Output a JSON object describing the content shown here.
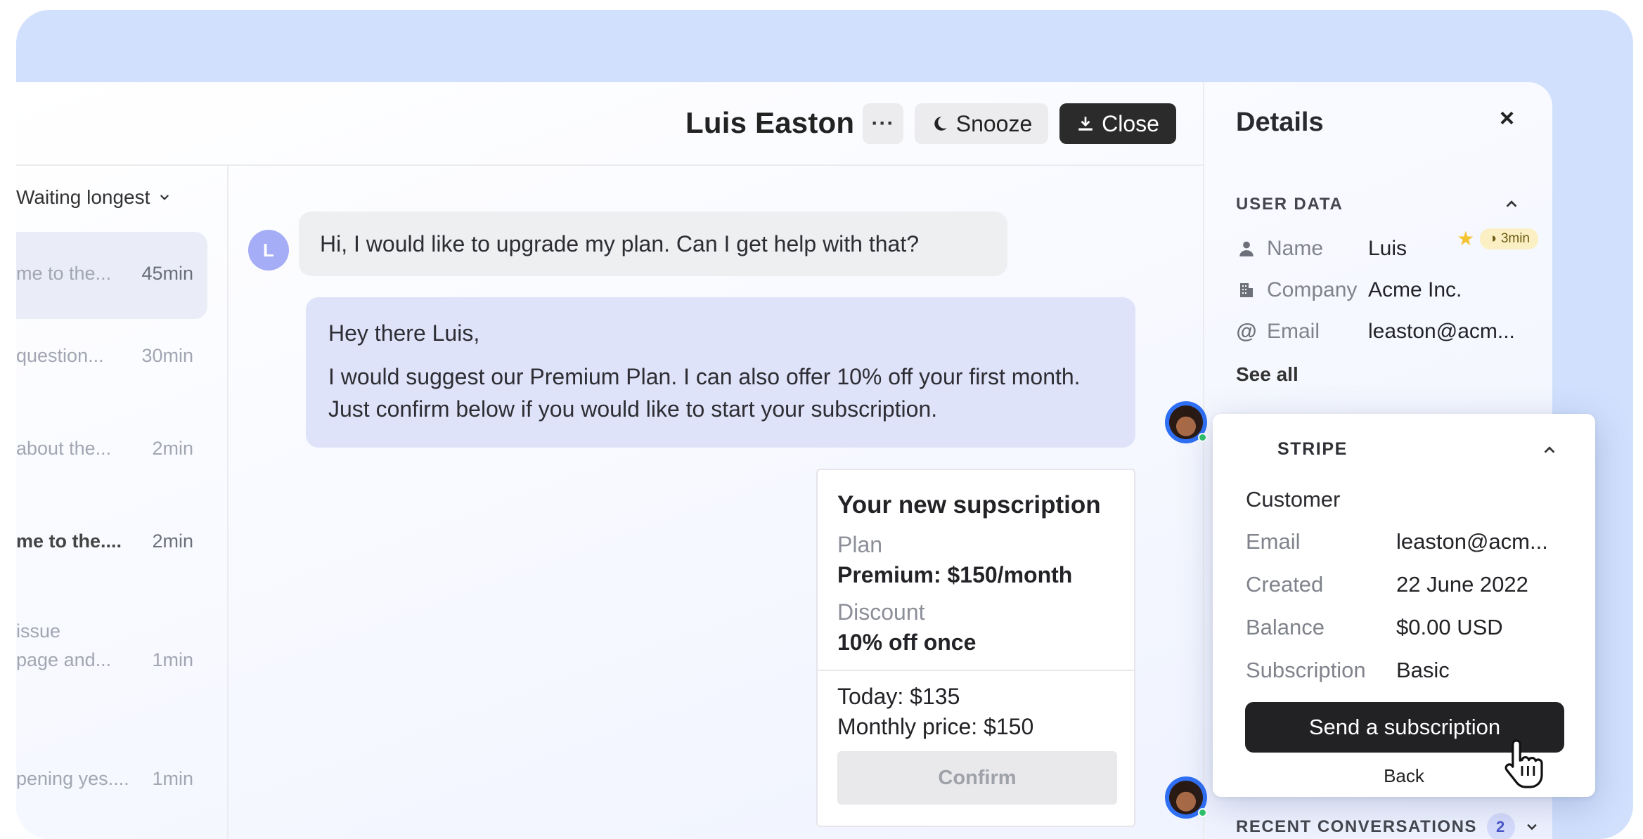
{
  "header": {
    "contact_name": "Luis Easton",
    "more_label": "···",
    "snooze_label": "Snooze",
    "close_label": "Close"
  },
  "inbox": {
    "sort_label": "Waiting longest",
    "items": [
      {
        "snippet": "me to the...",
        "time": "45min",
        "active": true
      },
      {
        "snippet": "question...",
        "time": "30min",
        "sla": "3min",
        "starred": true
      },
      {
        "snippet": "about the...",
        "time": "2min"
      },
      {
        "snippet": "me to the....",
        "time": "2min",
        "unread": true
      },
      {
        "snippet_line1": "issue",
        "snippet": "page and...",
        "time": "1min"
      },
      {
        "snippet": "pening yes....",
        "time": "1min"
      }
    ]
  },
  "conversation": {
    "customer_initial": "L",
    "customer_message": "Hi, I would like to upgrade my plan. Can I get help with that?",
    "agent_greeting": "Hey there Luis,",
    "agent_message": "I would suggest our Premium Plan. I can also offer 10% off your first month. Just confirm below if you would like to start your subscription."
  },
  "subscription_card": {
    "title": "Your new supscription",
    "plan_label": "Plan",
    "plan_value": "Premium: $150/month",
    "discount_label": "Discount",
    "discount_value": "10% off once",
    "today": "Today: $135",
    "monthly": "Monthly price: $150",
    "confirm_label": "Confirm"
  },
  "details": {
    "title": "Details",
    "close_glyph": "×",
    "user_data_header": "USER DATA",
    "fields": [
      {
        "icon": "person-icon",
        "label": "Name",
        "value": "Luis"
      },
      {
        "icon": "building-icon",
        "label": "Company",
        "value": "Acme Inc."
      },
      {
        "icon": "at-icon",
        "label": "Email",
        "value": "leaston@acm..."
      }
    ],
    "see_all": "See all",
    "recent_header": "RECENT CONVERSATIONS",
    "recent_count": "2"
  },
  "stripe": {
    "header": "STRIPE",
    "customer_label": "Customer",
    "rows": [
      {
        "label": "Email",
        "value": "leaston@acm..."
      },
      {
        "label": "Created",
        "value": "22 June 2022"
      },
      {
        "label": "Balance",
        "value": "$0.00 USD"
      },
      {
        "label": "Subscription",
        "value": "Basic"
      }
    ],
    "send_label": "Send a subscription",
    "back_label": "Back"
  },
  "colors": {
    "stage_bg": "#d1e0fd",
    "agent_bubble": "#dfe3f9",
    "customer_avatar": "#a5adf7",
    "primary_dark": "#222225",
    "online": "#2ec26b"
  }
}
